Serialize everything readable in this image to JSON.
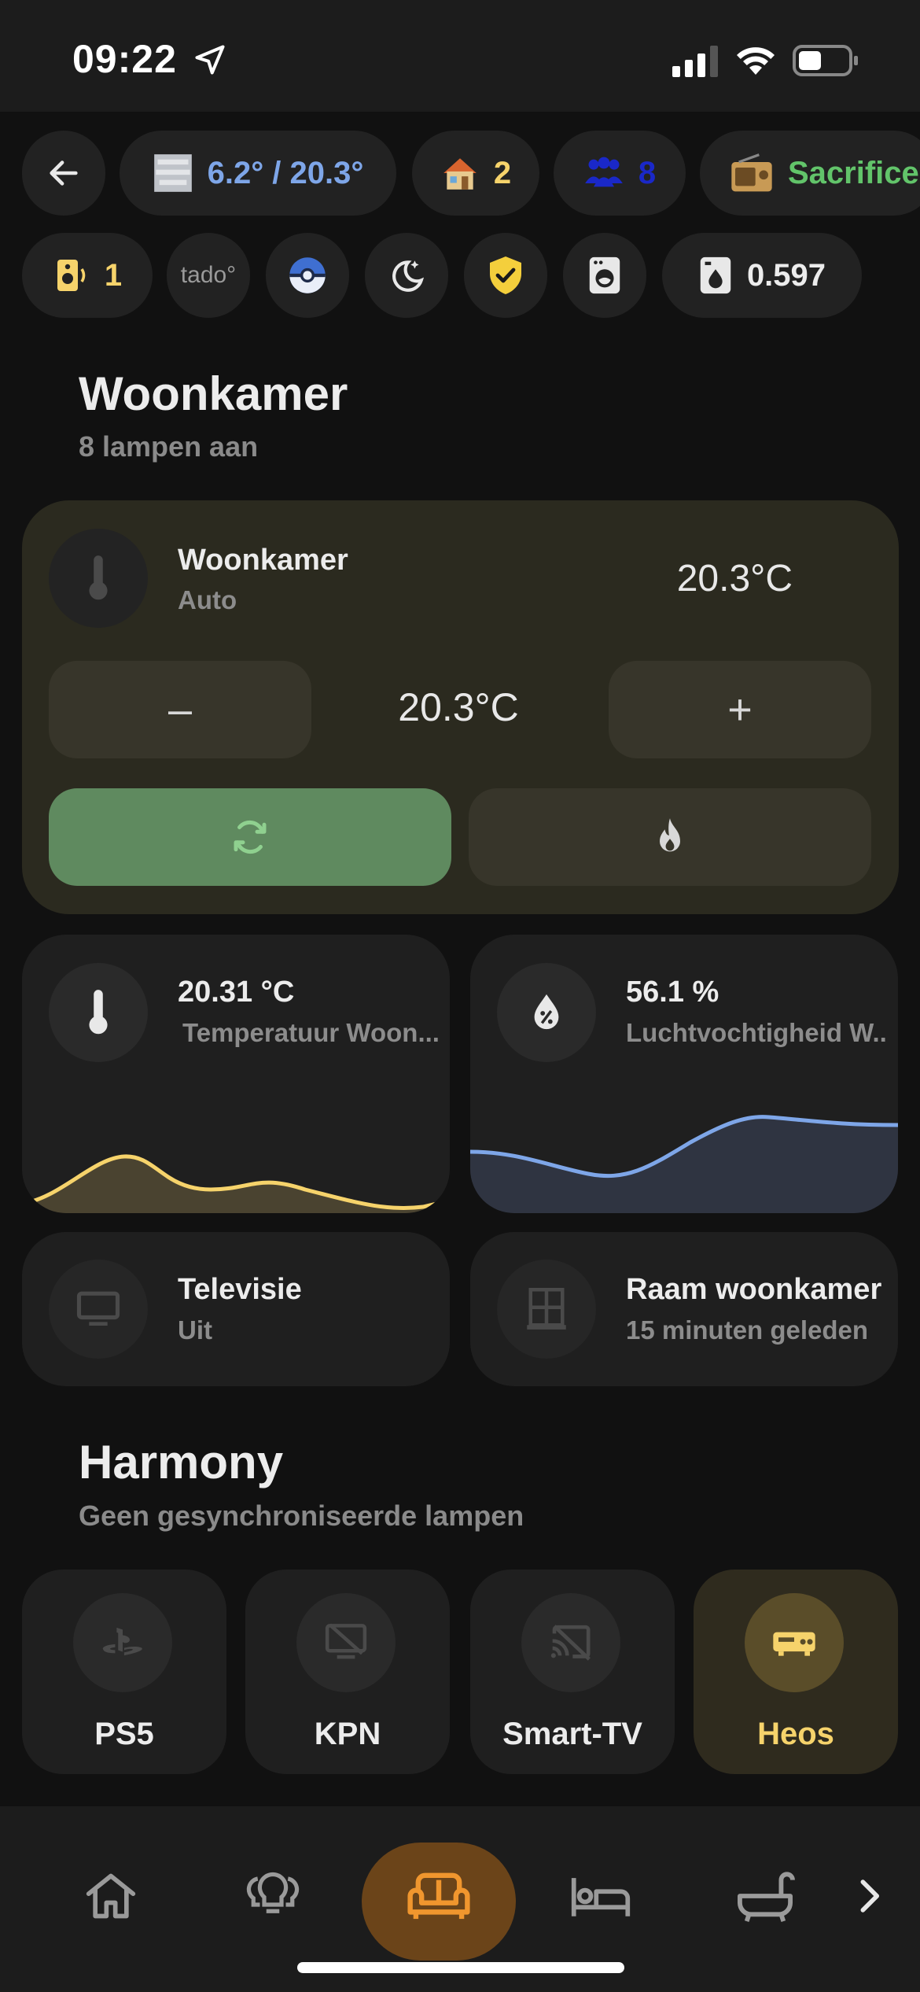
{
  "status_bar": {
    "time": "09:22"
  },
  "chips_row1": {
    "weather": "6.2° / 20.3°",
    "home_count": "2",
    "people_count": "8",
    "radio": "Sacrifice"
  },
  "chips_row2": {
    "speaker_count": "1",
    "tado": "tado°",
    "meter_value": "0.597"
  },
  "woonkamer": {
    "title": "Woonkamer",
    "subtitle": "8 lampen aan",
    "climate": {
      "name": "Woonkamer",
      "mode": "Auto",
      "current_temp": "20.3°C",
      "target_temp": "20.3°C",
      "minus": "–",
      "plus": "+"
    },
    "temperature": {
      "value": "20.31 °C",
      "label": "Temperatuur Woon..."
    },
    "humidity": {
      "value": "56.1 %",
      "label": "Luchtvochtigheid W..."
    },
    "tv": {
      "name": "Televisie",
      "state": "Uit"
    },
    "window": {
      "name": "Raam woonkamer",
      "state": "15 minuten geleden"
    }
  },
  "harmony": {
    "title": "Harmony",
    "subtitle": "Geen gesynchroniseerde lampen",
    "activities": [
      {
        "label": "PS5"
      },
      {
        "label": "KPN"
      },
      {
        "label": "Smart-TV"
      },
      {
        "label": "Heos"
      }
    ]
  },
  "colors": {
    "accent_yellow": "#f6d36b",
    "accent_blue": "#7ea6e8",
    "accent_green": "#62c46a",
    "accent_orange": "#f0962e",
    "climate_bg": "#2b2a1f",
    "active_mode": "#5f8a5f"
  },
  "icons": {
    "nav": [
      "home-icon",
      "lightbulb-group-icon",
      "sofa-icon",
      "bed-icon",
      "bathtub-icon",
      "chevron-right-icon"
    ]
  }
}
